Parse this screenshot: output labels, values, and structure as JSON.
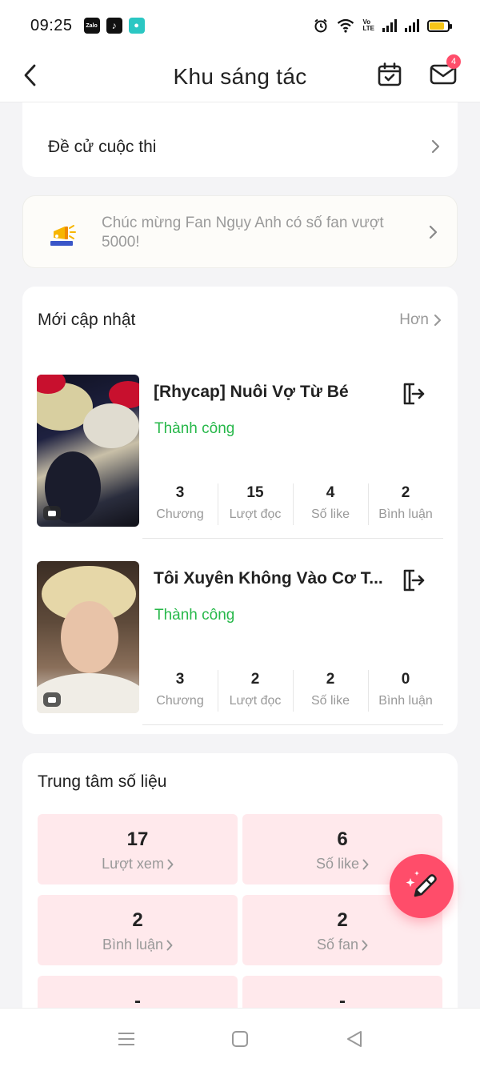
{
  "status_bar": {
    "time": "09:25",
    "apps": [
      "Zalo",
      "TikTok",
      "Messages"
    ],
    "zalo_label": "Zalo",
    "volte_top": "Vo",
    "volte_bottom": "LTE"
  },
  "header": {
    "title": "Khu sáng tác",
    "mail_badge": "4"
  },
  "contest": {
    "label": "Đề cử cuộc thi"
  },
  "notice": {
    "text": "Chúc mừng Fan Ngụy Anh có số fan vượt 5000!"
  },
  "updates": {
    "title": "Mới cập nhật",
    "more_label": "Hơn",
    "stories": [
      {
        "title": "[Rhycap] Nuôi Vợ Từ Bé",
        "status": "Thành công",
        "stats": [
          {
            "value": "3",
            "label": "Chương"
          },
          {
            "value": "15",
            "label": "Lượt đọc"
          },
          {
            "value": "4",
            "label": "Số like"
          },
          {
            "value": "2",
            "label": "Bình luận"
          }
        ]
      },
      {
        "title": "Tôi Xuyên Không Vào Cơ T...",
        "status": "Thành công",
        "stats": [
          {
            "value": "3",
            "label": "Chương"
          },
          {
            "value": "2",
            "label": "Lượt đọc"
          },
          {
            "value": "2",
            "label": "Số like"
          },
          {
            "value": "0",
            "label": "Bình luận"
          }
        ]
      }
    ]
  },
  "data_center": {
    "title": "Trung tâm số liệu",
    "tiles": [
      {
        "value": "17",
        "label": "Lượt xem"
      },
      {
        "value": "6",
        "label": "Số like"
      },
      {
        "value": "2",
        "label": "Bình luận"
      },
      {
        "value": "2",
        "label": "Số fan"
      },
      {
        "value": "-",
        "label": ""
      },
      {
        "value": "-",
        "label": ""
      }
    ]
  },
  "colors": {
    "accent": "#ff4d6a",
    "success": "#27b84a",
    "tile_bg": "#ffe9ec",
    "muted_text": "#999999"
  },
  "icons": {
    "back": "chevron-left-icon",
    "calendar": "calendar-check-icon",
    "mail": "mail-icon",
    "export": "export-icon",
    "fab": "pencil-sparkle-icon"
  }
}
